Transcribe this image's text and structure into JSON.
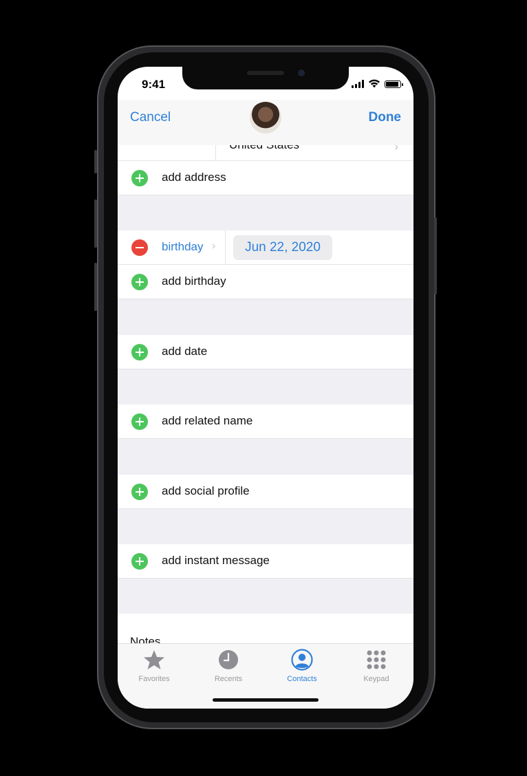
{
  "status": {
    "time": "9:41"
  },
  "nav": {
    "cancel": "Cancel",
    "done": "Done"
  },
  "address_partial": "United States",
  "rows": {
    "add_address": "add address",
    "birthday_label": "birthday",
    "birthday_value": "Jun 22, 2020",
    "add_birthday": "add birthday",
    "add_date": "add date",
    "add_related_name": "add related name",
    "add_social_profile": "add social profile",
    "add_instant_message": "add instant message",
    "notes": "Notes"
  },
  "tabs": [
    {
      "label": "Favorites",
      "icon": "star-icon",
      "active": false
    },
    {
      "label": "Recents",
      "icon": "clock-icon",
      "active": false
    },
    {
      "label": "Contacts",
      "icon": "person-circle-icon",
      "active": true
    },
    {
      "label": "Keypad",
      "icon": "keypad-icon",
      "active": false
    }
  ],
  "colors": {
    "accent": "#2f80d8",
    "add": "#4cc65c",
    "remove": "#e8443a",
    "group_bg": "#efeff4"
  }
}
